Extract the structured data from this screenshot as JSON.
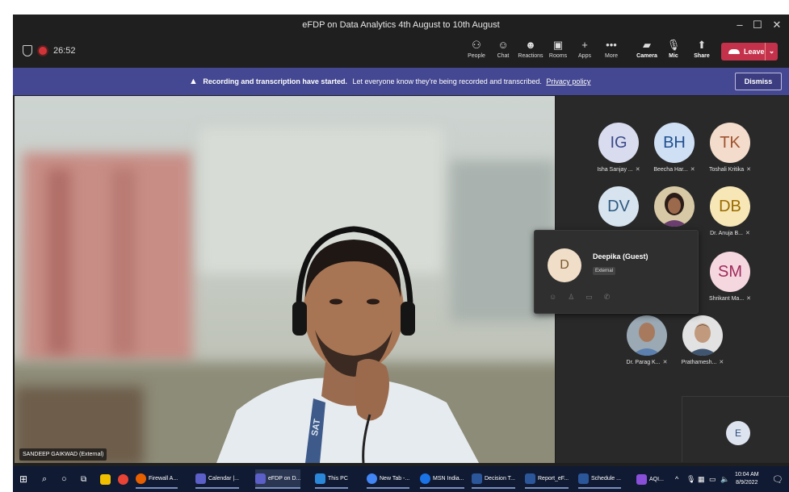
{
  "window": {
    "title": "eFDP on Data Analytics 4th August to 10th August",
    "controls": [
      "–",
      "☐",
      "✕"
    ]
  },
  "toolbar": {
    "timer": "26:52",
    "buttons": [
      {
        "icon": "people-icon",
        "glyph": "⚇",
        "label": "People"
      },
      {
        "icon": "chat-icon",
        "glyph": "☺",
        "label": "Chat"
      },
      {
        "icon": "reactions-icon",
        "glyph": "☻",
        "label": "Reactions"
      },
      {
        "icon": "rooms-icon",
        "glyph": "▣",
        "label": "Rooms"
      },
      {
        "icon": "apps-icon",
        "glyph": "+",
        "label": "Apps"
      },
      {
        "icon": "more-icon",
        "glyph": "•••",
        "label": "More"
      },
      {
        "icon": "camera-icon",
        "glyph": "▰",
        "label": "Camera"
      },
      {
        "icon": "mic-icon",
        "glyph": "🎙",
        "label": "Mic"
      },
      {
        "icon": "share-icon",
        "glyph": "⬆",
        "label": "Share"
      }
    ],
    "leave_label": "Leave"
  },
  "banner": {
    "bold_text": "Recording and transcription have started.",
    "text": "Let everyone know they're being recorded and transcribed.",
    "link": "Privacy policy",
    "dismiss_label": "Dismiss"
  },
  "main_video": {
    "name": "SANDEEP GAIKWAD (External)",
    "shirt_text": "SAT"
  },
  "participants": [
    {
      "initials": "IG",
      "name": "Isha Sanjay ...",
      "bg": "#d9dcef",
      "fg": "#3b4a8a"
    },
    {
      "initials": "BH",
      "name": "Beecha Har...",
      "bg": "#cfe0f5",
      "fg": "#1f4f8f"
    },
    {
      "initials": "TK",
      "name": "Toshali Kritika",
      "bg": "#f3dccb",
      "fg": "#a0522d"
    },
    {
      "initials": "DV",
      "name": "",
      "bg": "#d7e4ef",
      "fg": "#2e5a80"
    },
    {
      "initials": "",
      "name": "",
      "photo": true
    },
    {
      "initials": "DB",
      "name": "Dr. Anuja B...",
      "bg": "#f7e7b6",
      "fg": "#9a6a00"
    },
    {
      "initials": "SM",
      "name": "Shrikant Ma...",
      "bg": "#f5d7e0",
      "fg": "#a02a5a"
    },
    {
      "initials": "",
      "name": "Dr. Parag K...",
      "photo": true
    },
    {
      "initials": "",
      "name": "Prathamesh...",
      "photo": true
    }
  ],
  "hover_card": {
    "initial": "D",
    "name": "Deepika (Guest)",
    "tag": "External"
  },
  "self_view": {
    "initial": "E"
  },
  "taskbar": {
    "items": [
      {
        "label": "Firewall A...",
        "color": "#e66000"
      },
      {
        "label": "Calendar |...",
        "color": "#5b5fc7"
      },
      {
        "label": "eFDP on D...",
        "color": "#5b5fc7",
        "active": true
      },
      {
        "label": "This PC",
        "color": "#2b88d8"
      },
      {
        "label": "New Tab -...",
        "color": "#4285f4"
      },
      {
        "label": "MSN India...",
        "color": "#1b73e8"
      },
      {
        "label": "Decision T...",
        "color": "#2b579a"
      },
      {
        "label": "Report_eF...",
        "color": "#2b579a"
      },
      {
        "label": "Schedule ...",
        "color": "#2b579a"
      },
      {
        "label": "AQI...",
        "color": "#8a4fd8"
      }
    ],
    "time": "10:04 AM",
    "date": "8/9/2022"
  }
}
